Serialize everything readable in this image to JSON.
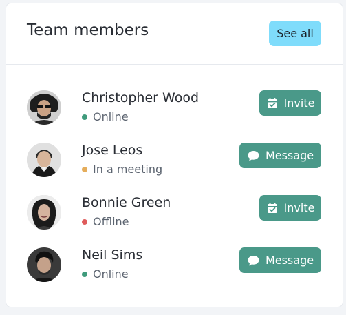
{
  "header": {
    "title": "Team members",
    "see_all_label": "See all"
  },
  "colors": {
    "accent": "#7fdcfb",
    "action": "#4a9989",
    "online": "#3f9b7c",
    "meeting": "#e5ad5b",
    "offline": "#df5b5b"
  },
  "members": [
    {
      "name": "Christopher Wood",
      "status": "Online",
      "status_color": "#3f9b7c",
      "action_label": "Invite",
      "action_icon": "calendar-check-icon"
    },
    {
      "name": "Jose Leos",
      "status": "In a meeting",
      "status_color": "#e5ad5b",
      "action_label": "Message",
      "action_icon": "chat-bubble-icon"
    },
    {
      "name": "Bonnie Green",
      "status": "Offline",
      "status_color": "#df5b5b",
      "action_label": "Invite",
      "action_icon": "calendar-check-icon"
    },
    {
      "name": "Neil Sims",
      "status": "Online",
      "status_color": "#3f9b7c",
      "action_label": "Message",
      "action_icon": "chat-bubble-icon"
    }
  ]
}
